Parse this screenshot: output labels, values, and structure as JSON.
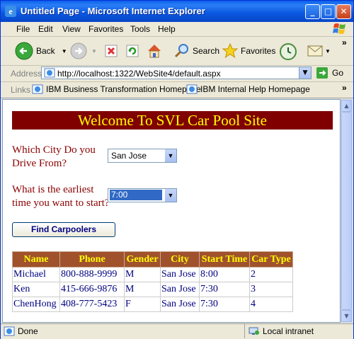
{
  "window": {
    "title": "Untitled Page - Microsoft Internet Explorer",
    "minimize_label": "_",
    "maximize_label": "□",
    "close_label": "✕"
  },
  "menu": [
    "File",
    "Edit",
    "View",
    "Favorites",
    "Tools",
    "Help"
  ],
  "toolbar": {
    "back_label": "Back",
    "search_label": "Search",
    "favorites_label": "Favorites",
    "more_label": "»"
  },
  "address": {
    "label": "Address",
    "url": "http://localhost:1322/WebSite4/default.aspx",
    "go_label": "Go"
  },
  "links": {
    "label": "Links",
    "items": [
      "IBM Business Transformation Homepage",
      "IBM Internal Help Homepage"
    ],
    "more_label": "»"
  },
  "page": {
    "banner": "Welcome To SVL Car Pool Site",
    "city_label": "Which City Do you Drive From?",
    "city_value": "San Jose",
    "time_label": "What is the earliest time you want to start?",
    "time_value": "7:00",
    "find_button": "Find Carpoolers",
    "table": {
      "headers": [
        "Name",
        "Phone",
        "Gender",
        "City",
        "Start Time",
        "Car Type"
      ],
      "rows": [
        [
          "Michael",
          "800-888-9999",
          "M",
          "San Jose",
          "8:00",
          "2"
        ],
        [
          "Ken",
          "415-666-9876",
          "M",
          "San Jose",
          "7:30",
          "3"
        ],
        [
          "ChenHong",
          "408-777-5423",
          "F",
          "San Jose",
          "7:30",
          "4"
        ]
      ]
    }
  },
  "status": {
    "text": "Done",
    "zone": "Local intranet"
  },
  "colors": {
    "banner_bg": "#800000",
    "banner_text": "#ffff00",
    "label_text": "#8b0000",
    "table_header_bg": "#a0522d",
    "table_text": "#000080"
  }
}
